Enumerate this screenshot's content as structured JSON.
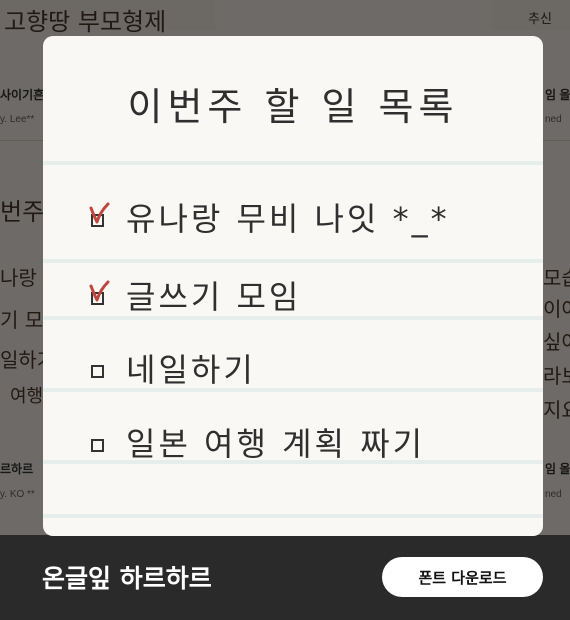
{
  "background": {
    "card_top_left_title": "고향땅 부모형제",
    "card_top_right_label": "추신",
    "left_card_name": "사이기흔",
    "left_card_author": "y. Lee**",
    "right_card_name": "임 올",
    "right_card_author": "ned",
    "left_card_body_title": "번주",
    "left_card_body_lines": [
      "나랑 무",
      "기 모",
      "일하기",
      "여행"
    ],
    "right_card_body_lines": [
      "모습",
      "이어",
      "싶어",
      "라보",
      "지요"
    ],
    "left_bottom_name": "르하르",
    "left_bottom_author": "y. KO **",
    "right_bottom_name": "임 올",
    "right_bottom_author": "ned"
  },
  "note": {
    "title": "이번주 할 일 목록",
    "items": [
      {
        "text": "유나랑 무비 나잇 *_*",
        "checked": true
      },
      {
        "text": "글쓰기 모임",
        "checked": true
      },
      {
        "text": "네일하기",
        "checked": false
      },
      {
        "text": "일본 여행 계획 짜기",
        "checked": false
      }
    ],
    "check_color": "#c0463f"
  },
  "footer": {
    "font_name": "온글잎 하르하르",
    "download_label": "폰트 다운로드"
  }
}
